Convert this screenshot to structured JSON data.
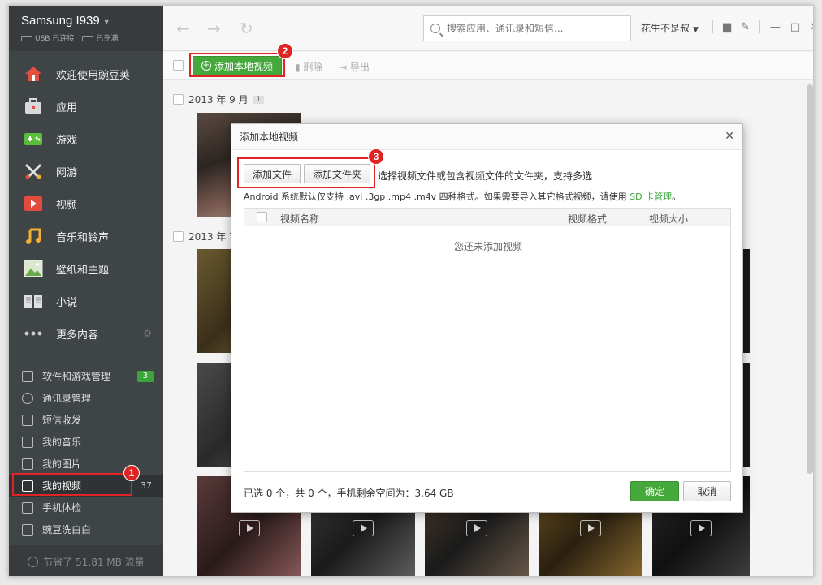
{
  "device": {
    "name": "Samsung I939",
    "usb": "USB 已连接",
    "battery": "已充满"
  },
  "sidebar": {
    "nav": [
      {
        "label": "欢迎使用豌豆荚",
        "icon": "home-icon",
        "color": "#e25040"
      },
      {
        "label": "应用",
        "icon": "briefcase-icon",
        "color": "#d9d9d9"
      },
      {
        "label": "游戏",
        "icon": "gamepad-icon",
        "color": "#5bbd3b"
      },
      {
        "label": "网游",
        "icon": "swords-icon",
        "color": "#e0e0e0"
      },
      {
        "label": "视频",
        "icon": "play-icon",
        "color": "#e44b3e"
      },
      {
        "label": "音乐和铃声",
        "icon": "music-icon",
        "color": "#f2b134"
      },
      {
        "label": "壁纸和主题",
        "icon": "picture-icon",
        "color": "#8fc25f"
      },
      {
        "label": "小说",
        "icon": "book-icon",
        "color": "#e0e0e0"
      },
      {
        "label": "更多内容",
        "icon": "more-icon",
        "color": "#cccccc"
      }
    ],
    "tools": [
      {
        "label": "软件和游戏管理",
        "badge": "3"
      },
      {
        "label": "通讯录管理"
      },
      {
        "label": "短信收发"
      },
      {
        "label": "我的音乐"
      },
      {
        "label": "我的图片"
      },
      {
        "label": "我的视频",
        "count": "37"
      },
      {
        "label": "手机体检"
      },
      {
        "label": "豌豆洗白白"
      }
    ],
    "footer": "节省了 51.81 MB 流量"
  },
  "topbar": {
    "search_placeholder": "搜索应用、通讯录和短信...",
    "user": "花生不是叔"
  },
  "toolbar": {
    "add_label": "添加本地视频",
    "delete_label": "删除",
    "export_label": "导出"
  },
  "groups": [
    {
      "label": "2013 年 9 月",
      "count": "1"
    },
    {
      "label": "2013 年 7"
    }
  ],
  "modal": {
    "title": "添加本地视频",
    "add_file": "添加文件",
    "add_folder": "添加文件夹",
    "hint": "选择视频文件或包含视频文件的文件夹，支持多选",
    "support_text": "Android 系统默认仅支持 .avi .3gp .mp4 .m4v 四种格式。如果需要导入其它格式视频，请使用",
    "support_link": "SD 卡管理",
    "support_end": "。",
    "col_name": "视频名称",
    "col_format": "视频格式",
    "col_size": "视频大小",
    "empty": "您还未添加视频",
    "summary": "已选 0 个，共 0 个，手机剩余空间为：3.64 GB",
    "ok": "确定",
    "cancel": "取消"
  },
  "annotations": [
    "1",
    "2",
    "3"
  ],
  "colors": {
    "accent_green": "#45a83b",
    "highlight_red": "#e02424",
    "sidebar_bg": "#3f4447"
  }
}
